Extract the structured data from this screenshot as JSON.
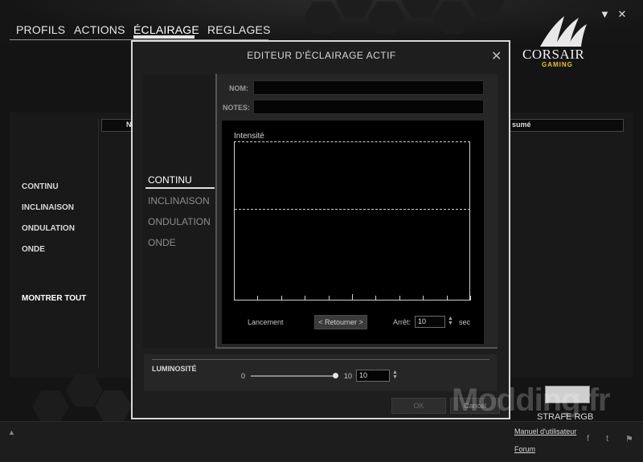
{
  "nav": {
    "tabs": [
      "PROFILS",
      "ACTIONS",
      "ÉCLAIRAGE",
      "REGLAGES"
    ],
    "active_tab": "ÉCLAIRAGE"
  },
  "window": {
    "minimize": "▼",
    "close": "✕"
  },
  "logo": {
    "name": "CORSAIR",
    "tagline": "GAMING"
  },
  "background": {
    "effects": [
      "CONTINU",
      "INCLINAISON",
      "ONDULATION",
      "ONDE"
    ],
    "show_all": "MONTRER TOUT",
    "col_header_left": "N",
    "col_header_right": "sumé"
  },
  "modal": {
    "title": "EDITEUR D'ÉCLAIRAGE ACTIF",
    "close": "✕",
    "effects": [
      "CONTINU",
      "INCLINAISON",
      "ONDULATION",
      "ONDE"
    ],
    "active_effect": "CONTINU",
    "name_label": "NOM:",
    "name_value": "",
    "notes_label": "NOTES:",
    "notes_value": "",
    "graph": {
      "title": "Intensité",
      "launch_label": "Lancement",
      "back_button": "< Retourner >",
      "stop_label": "Arrêt:",
      "stop_value": "10",
      "unit": "sec"
    },
    "brightness": {
      "label": "LUMINOSITÉ",
      "min": "0",
      "max": "10",
      "value": "10",
      "level": 1.0
    },
    "ok_label": "OK",
    "cancel_label": "Cancel"
  },
  "device": {
    "name": "STRAFE RGB",
    "manual_link": "Manuel d'utilisateur",
    "forum_link": "Forum"
  },
  "watermark": "Modding.fr"
}
